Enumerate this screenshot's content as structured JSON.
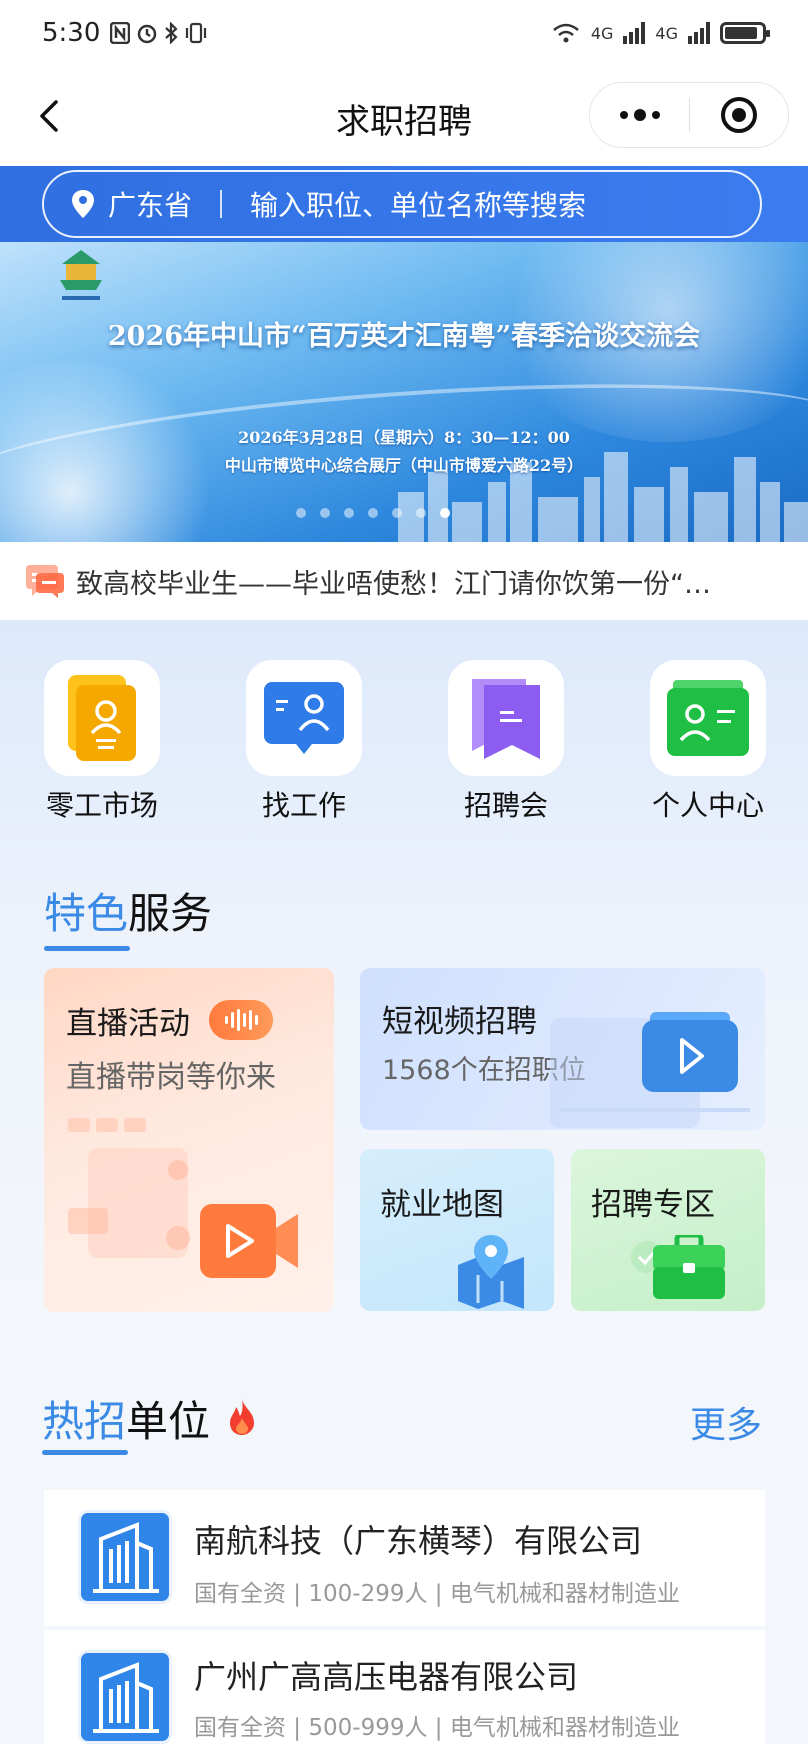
{
  "status_bar": {
    "time": "5:30",
    "network_label_1": "4G",
    "network_label_2": "4G",
    "signal_prefix": "6"
  },
  "header": {
    "title": "求职招聘"
  },
  "search": {
    "location": "广东省",
    "placeholder": "输入职位、单位名称等搜索"
  },
  "banner": {
    "title": "2026年中山市“百万英才汇南粤”春季洽谈交流会",
    "date": "2026年3月28日（星期六）8：30—12：00",
    "venue": "中山市博览中心综合展厅（中山市博爱六路22号）",
    "dot_count": 7,
    "active_dot": 6
  },
  "notice": {
    "text": "致高校毕业生——毕业唔使愁！江门请你饮第一份“…"
  },
  "quick_entries": [
    {
      "label": "零工市场",
      "icon": "odd-job-market-icon",
      "color": "#f7b500"
    },
    {
      "label": "找工作",
      "icon": "find-job-icon",
      "color": "#2f7ce8"
    },
    {
      "label": "招聘会",
      "icon": "job-fair-icon",
      "color": "#8d5cf0"
    },
    {
      "label": "个人中心",
      "icon": "personal-center-icon",
      "color": "#1fbf45"
    }
  ],
  "featured": {
    "title_highlight": "特色",
    "title_rest": "服务",
    "live": {
      "title": "直播活动",
      "subtitle": "直播带岗等你来"
    },
    "video": {
      "title": "短视频招聘",
      "subtitle": "1568个在招职位"
    },
    "map": {
      "title": "就业地图"
    },
    "zone": {
      "title": "招聘专区"
    }
  },
  "hot": {
    "title_highlight": "热招",
    "title_rest": "单位",
    "more": "更多",
    "companies": [
      {
        "name": "南航科技（广东横琴）有限公司",
        "meta": "国有全资 | 100-299人 | 电气机械和器材制造业"
      },
      {
        "name": "广州广高高压电器有限公司",
        "meta": "国有全资 | 500-999人 | 电气机械和器材制造业"
      }
    ]
  },
  "colors": {
    "accent": "#3b8be6",
    "search_bar": "#2f6fe0",
    "live_badge": "#ff7a3d"
  }
}
